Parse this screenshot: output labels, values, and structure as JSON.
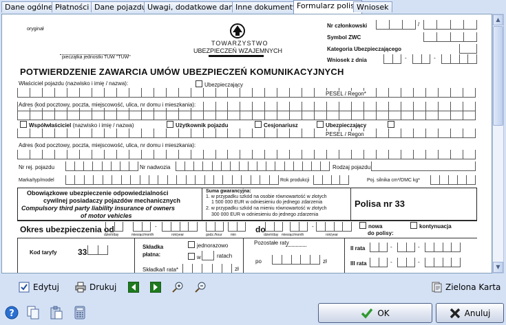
{
  "tabs": [
    "Dane ogólne",
    "Płatności",
    "Dane pojazdu",
    "Uwagi, dodatkowe dane",
    "Inne dokumenty",
    "Formularz polisy",
    "Wniosek"
  ],
  "active_tab": "Formularz polisy",
  "form": {
    "oryginal": "oryginał",
    "stamp": "pieczątka jednostki TUW \"TUW\"",
    "logo_line1": "TOWARZYSTWO",
    "logo_line2": "UBEZPIECZEŃ WZAJEMNYCH",
    "nr_czlonkowski": "Nr członkowski",
    "symbol_zwc": "Symbol ZWC",
    "kategoria": "Kategoria Ubezpieczającego",
    "wniosek_z_dnia": "Wniosek z dnia",
    "title": "POTWIERDZENIE ZAWARCIA UMÓW UBEZPIECZEŃ KOMUNIKACYJNYCH",
    "wlasciciel": "Właściciel pojazdu (nazwisko i imię / nazwa):",
    "ubezpieczajacy": "Ubezpieczający",
    "pesel": "PESEL / Regon*",
    "adres": "Adres (kod pocztowy, poczta, miejscowość, ulica, nr domu i mieszkania):",
    "wspolwlasciciel": "Współwłaściciel",
    "wspol_sub": "(nazwisko i imię / nazwa)",
    "uzytkownik": "Użytkownik pojazdu",
    "cesjonariusz": "Cesjonariusz",
    "ubezpieczajacy2": "Ubezpieczający",
    "pesel2": "PESEL / Regon",
    "adres2": "Adres (kod pocztowy, poczta, miejscowość, ulica, nr domu i mieszkania):",
    "nr_rej": "Nr rej. pojazdu",
    "nr_nadwozia": "Nr nadwozia",
    "rodzaj": "Rodzaj pojazdu",
    "marka": "Marka/typ/model",
    "rok": "Rok produkcji",
    "poj": "Poj. silnika cm³/DMC kg*",
    "oblig1": "Obowiązkowe ubezpieczenie odpowiedzialności",
    "oblig2": "cywilnej posiadaczy pojazdów mechanicznych",
    "oblig3": "Compulsory third party liability insurance of owners",
    "oblig4": "of motor vehicles",
    "suma": "Suma gwarancyjna:",
    "suma1a": "1. w przypadku szkód na osobie równowartość w złotych",
    "suma1b": "1 500 000 EUR w odniesieniu do jednego zdarzenia",
    "suma2a": "2. w przypadku szkód na mieniu równowartość w złotych",
    "suma2b": "300 000 EUR w odniesieniu do jednego zdarzenia",
    "polisa": "Polisa nr 33",
    "okres": "Okres ubezpieczenia od",
    "do": "do",
    "sub_from": [
      "dzień/day",
      "miesiąc/month",
      "rok/year",
      "godz./hour",
      "min"
    ],
    "sub_to": [
      "dzień/day",
      "miesiąc/month",
      "rok/year"
    ],
    "nowa": "nowa",
    "kontynuacja": "kontynuacja",
    "do_polisy": "do polisy:",
    "kod_taryfy": "Kod taryfy",
    "kod_value": "33",
    "skladka": "Składka",
    "platna": "płatna:",
    "jednorazowo": "jednorazowo",
    "w": "w",
    "ratach": "ratach",
    "skladka_rata": "Składka/I rata*",
    "zl": "zł",
    "pozostale": "Pozostałe raty",
    "po": "po",
    "zl2": "zł",
    "ii_rata": "II rata",
    "iii_rata": "III rata"
  },
  "toolbar": {
    "edytuj": "Edytuj",
    "drukuj": "Drukuj",
    "zielona_karta": "Zielona Karta"
  },
  "buttons": {
    "ok": "OK",
    "anuluj": "Anuluj"
  },
  "colors": {
    "background": "#d4e1f5",
    "ok_check": "#2e9a2e",
    "cancel_x": "#222222",
    "nav_arrow": "#1e7a1e"
  }
}
